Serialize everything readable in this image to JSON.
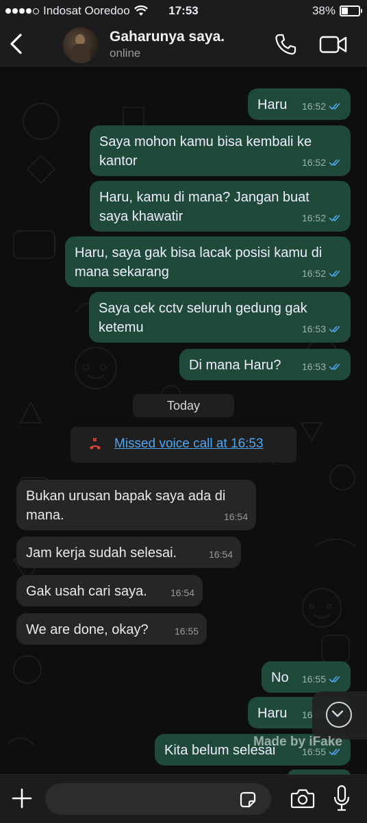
{
  "status_bar": {
    "carrier": "Indosat Ooredoo",
    "time": "17:53",
    "battery": "38%",
    "battery_level": 0.38
  },
  "header": {
    "contact_name": "Gaharunya saya.",
    "contact_status": "online"
  },
  "messages_before": [
    {
      "text": "Haru",
      "time": "16:52",
      "direction": "out"
    },
    {
      "text": "Saya mohon kamu bisa kembali ke kantor",
      "time": "16:52",
      "direction": "out"
    },
    {
      "text": "Haru, kamu di mana? Jangan buat saya khawatir",
      "time": "16:52",
      "direction": "out"
    },
    {
      "text": "Haru, saya gak bisa lacak posisi kamu di mana sekarang",
      "time": "16:52",
      "direction": "out"
    },
    {
      "text": "Saya cek cctv seluruh gedung gak ketemu",
      "time": "16:53",
      "direction": "out"
    },
    {
      "text": "Di mana Haru?",
      "time": "16:53",
      "direction": "out"
    }
  ],
  "date_divider": "Today",
  "missed_call": "Missed voice call at 16:53",
  "messages_after": [
    {
      "text": "Bukan urusan bapak saya ada di mana.",
      "time": "16:54",
      "direction": "in"
    },
    {
      "text": "Jam kerja sudah selesai.",
      "time": "16:54",
      "direction": "in"
    },
    {
      "text": "Gak usah cari saya.",
      "time": "16:54",
      "direction": "in"
    },
    {
      "text": "We are done, okay?",
      "time": "16:55",
      "direction": "in"
    },
    {
      "text": "No",
      "time": "16:55",
      "direction": "out"
    },
    {
      "text": "Haru",
      "time": "16:55",
      "direction": "out"
    },
    {
      "text": "Kita belum selesai",
      "time": "16:55",
      "direction": "out"
    }
  ],
  "watermark": "Made by iFake",
  "input": {
    "placeholder": ""
  },
  "colors": {
    "outgoing_bubble": "#1f4a3a",
    "incoming_bubble": "#262626",
    "link": "#4fa7f0",
    "missed_call_icon": "#e0453a",
    "read_ticks": "#4fa7f0"
  },
  "icons": [
    "back-chevron-icon",
    "phone-icon",
    "video-camera-icon",
    "missed-call-icon",
    "chevron-down-icon",
    "plus-icon",
    "sticker-icon",
    "camera-icon",
    "microphone-icon",
    "read-ticks-icon",
    "wifi-icon",
    "battery-icon"
  ]
}
